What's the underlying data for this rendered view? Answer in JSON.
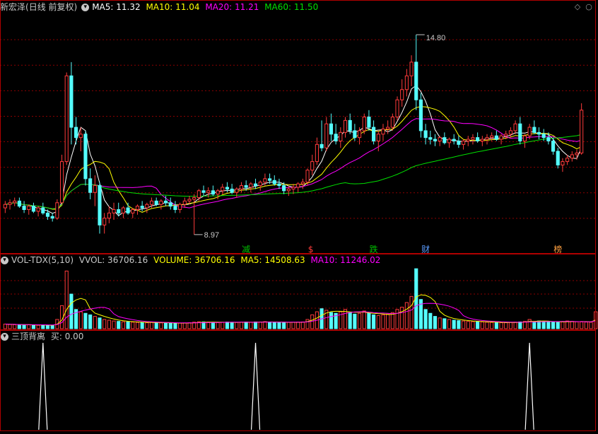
{
  "colors": {
    "background": "#000000",
    "up": "#ff3b3b",
    "down": "#54fcfc",
    "ma5": "#ffffff",
    "ma10": "#ffff00",
    "ma20": "#ff00ff",
    "ma60": "#00e000",
    "grid": "#8b0000"
  },
  "header": {
    "stock": "新宏泽",
    "period": "(日线 前复权)",
    "dropdown_icon": "chevron-down-icon",
    "ma5": "MA5: 11.32",
    "ma10": "MA10: 11.04",
    "ma20": "MA20: 11.21",
    "ma60": "MA60: 11.50"
  },
  "price_markers": {
    "high": "14.80",
    "low": "8.97"
  },
  "event_tags": [
    "减",
    "$",
    "跌",
    "财",
    "榜"
  ],
  "volume_header": {
    "indicator": "VOL-TDX(5,10)",
    "vvol": "VVOL: 36706.16",
    "volume": "VOLUME: 36706.16",
    "ma5": "MA5: 14508.63",
    "ma10": "MA10: 11246.02"
  },
  "signal_header": {
    "indicator": "三顶背离",
    "buy": "买: 0.00"
  },
  "chart_data": [
    {
      "type": "candlestick",
      "title": "新宏泽(日线 前复权)",
      "ylim": [
        8.7,
        15.4
      ],
      "series": [
        {
          "name": "MA5",
          "value": 11.32
        },
        {
          "name": "MA10",
          "value": 11.04
        },
        {
          "name": "MA20",
          "value": 11.21
        },
        {
          "name": "MA60",
          "value": 11.5
        }
      ],
      "annotations": {
        "max": 14.8,
        "min": 8.97
      },
      "ohlc": [
        [
          9.75,
          9.95,
          9.6,
          9.85
        ],
        [
          9.85,
          10.0,
          9.7,
          9.9
        ],
        [
          9.9,
          10.05,
          9.8,
          9.95
        ],
        [
          9.95,
          10.05,
          9.75,
          9.8
        ],
        [
          9.8,
          9.95,
          9.6,
          9.7
        ],
        [
          9.7,
          9.85,
          9.55,
          9.8
        ],
        [
          9.8,
          9.9,
          9.6,
          9.65
        ],
        [
          9.65,
          9.8,
          9.5,
          9.75
        ],
        [
          9.75,
          9.9,
          9.55,
          9.6
        ],
        [
          9.6,
          9.7,
          9.4,
          9.5
        ],
        [
          9.5,
          9.6,
          9.35,
          9.45
        ],
        [
          9.45,
          10.0,
          9.4,
          9.9
        ],
        [
          9.9,
          11.3,
          9.85,
          11.1
        ],
        [
          11.1,
          13.7,
          11.0,
          13.6
        ],
        [
          13.6,
          14.0,
          11.6,
          12.1
        ],
        [
          12.1,
          12.4,
          11.6,
          11.8
        ],
        [
          11.8,
          12.1,
          11.4,
          11.9
        ],
        [
          11.9,
          12.0,
          10.4,
          10.6
        ],
        [
          10.6,
          10.9,
          10.0,
          10.2
        ],
        [
          10.2,
          10.7,
          9.8,
          10.4
        ],
        [
          10.4,
          10.5,
          9.0,
          9.25
        ],
        [
          9.25,
          9.6,
          9.0,
          9.45
        ],
        [
          9.45,
          9.8,
          9.3,
          9.6
        ],
        [
          9.6,
          9.9,
          9.4,
          9.7
        ],
        [
          9.7,
          9.9,
          9.5,
          9.6
        ],
        [
          9.6,
          9.8,
          9.45,
          9.75
        ],
        [
          9.75,
          9.9,
          9.55,
          9.6
        ],
        [
          9.6,
          9.75,
          9.45,
          9.7
        ],
        [
          9.7,
          9.85,
          9.55,
          9.8
        ],
        [
          9.8,
          9.95,
          9.65,
          9.75
        ],
        [
          9.75,
          9.9,
          9.6,
          9.85
        ],
        [
          9.85,
          10.05,
          9.75,
          9.95
        ],
        [
          9.95,
          10.05,
          9.8,
          9.85
        ],
        [
          9.85,
          10.0,
          9.7,
          9.95
        ],
        [
          9.95,
          10.1,
          9.8,
          9.9
        ],
        [
          9.9,
          10.05,
          9.7,
          9.8
        ],
        [
          9.8,
          9.95,
          9.6,
          9.7
        ],
        [
          9.7,
          9.9,
          9.6,
          9.85
        ],
        [
          9.85,
          10.05,
          9.75,
          9.95
        ],
        [
          9.95,
          10.1,
          9.85,
          10.0
        ],
        [
          10.0,
          10.15,
          8.97,
          10.05
        ],
        [
          10.05,
          10.3,
          9.95,
          10.25
        ],
        [
          10.25,
          10.4,
          10.1,
          10.2
        ],
        [
          10.2,
          10.35,
          10.05,
          10.25
        ],
        [
          10.25,
          10.4,
          10.1,
          10.15
        ],
        [
          10.15,
          10.3,
          10.0,
          10.25
        ],
        [
          10.25,
          10.45,
          10.15,
          10.35
        ],
        [
          10.35,
          10.5,
          10.2,
          10.3
        ],
        [
          10.3,
          10.45,
          10.15,
          10.2
        ],
        [
          10.2,
          10.35,
          10.05,
          10.3
        ],
        [
          10.3,
          10.5,
          10.2,
          10.4
        ],
        [
          10.4,
          10.55,
          10.25,
          10.35
        ],
        [
          10.35,
          10.5,
          10.2,
          10.45
        ],
        [
          10.45,
          10.6,
          10.3,
          10.4
        ],
        [
          10.4,
          10.55,
          10.25,
          10.5
        ],
        [
          10.5,
          10.75,
          10.4,
          10.6
        ],
        [
          10.6,
          10.75,
          10.45,
          10.55
        ],
        [
          10.55,
          10.7,
          10.4,
          10.45
        ],
        [
          10.45,
          10.6,
          10.3,
          10.4
        ],
        [
          10.4,
          10.5,
          10.15,
          10.25
        ],
        [
          10.25,
          10.4,
          10.1,
          10.3
        ],
        [
          10.3,
          10.45,
          10.15,
          10.35
        ],
        [
          10.35,
          10.5,
          10.2,
          10.45
        ],
        [
          10.45,
          10.6,
          10.3,
          10.5
        ],
        [
          10.5,
          10.9,
          10.4,
          10.85
        ],
        [
          10.85,
          11.3,
          10.7,
          11.1
        ],
        [
          11.1,
          11.8,
          11.0,
          11.6
        ],
        [
          11.6,
          12.3,
          11.4,
          11.5
        ],
        [
          11.5,
          12.4,
          11.4,
          12.2
        ],
        [
          12.2,
          12.5,
          11.7,
          11.9
        ],
        [
          11.9,
          12.2,
          11.6,
          11.7
        ],
        [
          11.7,
          12.1,
          11.5,
          11.95
        ],
        [
          11.95,
          12.4,
          11.8,
          12.3
        ],
        [
          12.3,
          12.5,
          11.9,
          12.0
        ],
        [
          12.0,
          12.2,
          11.7,
          11.8
        ],
        [
          11.8,
          12.1,
          11.6,
          12.0
        ],
        [
          12.0,
          12.5,
          11.9,
          12.4
        ],
        [
          12.4,
          12.6,
          12.0,
          12.1
        ],
        [
          12.1,
          12.3,
          11.6,
          11.7
        ],
        [
          11.7,
          12.0,
          11.4,
          11.9
        ],
        [
          11.9,
          12.2,
          11.7,
          12.05
        ],
        [
          12.05,
          12.3,
          11.9,
          12.1
        ],
        [
          12.1,
          12.5,
          12.0,
          12.4
        ],
        [
          12.4,
          13.0,
          12.3,
          12.9
        ],
        [
          12.9,
          13.5,
          12.7,
          13.2
        ],
        [
          13.2,
          13.8,
          13.0,
          13.6
        ],
        [
          13.6,
          14.2,
          13.3,
          14.0
        ],
        [
          14.0,
          14.8,
          12.6,
          12.9
        ],
        [
          12.9,
          13.1,
          11.8,
          12.0
        ],
        [
          12.0,
          12.2,
          11.6,
          11.8
        ],
        [
          11.8,
          12.0,
          11.6,
          11.75
        ],
        [
          11.75,
          11.9,
          11.55,
          11.7
        ],
        [
          11.7,
          11.85,
          11.55,
          11.8
        ],
        [
          11.8,
          11.95,
          11.6,
          11.65
        ],
        [
          11.65,
          11.8,
          11.5,
          11.75
        ],
        [
          11.75,
          11.9,
          11.6,
          11.7
        ],
        [
          11.7,
          11.85,
          11.5,
          11.6
        ],
        [
          11.6,
          11.75,
          11.45,
          11.7
        ],
        [
          11.7,
          11.85,
          11.55,
          11.75
        ],
        [
          11.75,
          11.9,
          11.6,
          11.8
        ],
        [
          11.8,
          11.95,
          11.65,
          11.7
        ],
        [
          11.7,
          11.85,
          11.55,
          11.75
        ],
        [
          11.75,
          11.9,
          11.6,
          11.8
        ],
        [
          11.8,
          11.95,
          11.7,
          11.85
        ],
        [
          11.85,
          12.0,
          11.7,
          11.75
        ],
        [
          11.75,
          11.9,
          11.6,
          11.85
        ],
        [
          11.85,
          12.0,
          11.75,
          11.9
        ],
        [
          11.9,
          12.1,
          11.8,
          12.0
        ],
        [
          12.0,
          12.3,
          11.9,
          12.2
        ],
        [
          12.2,
          12.4,
          11.6,
          11.7
        ],
        [
          11.7,
          11.9,
          11.5,
          11.85
        ],
        [
          11.85,
          12.2,
          11.75,
          12.1
        ],
        [
          12.1,
          12.3,
          11.9,
          11.95
        ],
        [
          11.95,
          12.1,
          11.75,
          11.9
        ],
        [
          11.9,
          12.05,
          11.7,
          11.8
        ],
        [
          11.8,
          11.95,
          11.6,
          11.7
        ],
        [
          11.7,
          11.8,
          11.3,
          11.4
        ],
        [
          11.4,
          11.5,
          10.9,
          11.0
        ],
        [
          11.0,
          11.2,
          10.8,
          11.1
        ],
        [
          11.1,
          11.3,
          11.0,
          11.2
        ],
        [
          11.2,
          11.4,
          11.1,
          11.3
        ],
        [
          11.3,
          11.45,
          11.15,
          11.35
        ],
        [
          11.35,
          12.8,
          11.3,
          12.6
        ]
      ]
    },
    {
      "type": "bar",
      "title": "VOL-TDX(5,10)",
      "series": [
        {
          "name": "VOLUME",
          "last": 36706.16
        },
        {
          "name": "MA5",
          "last": 14508.63
        },
        {
          "name": "MA10",
          "last": 11246.02
        }
      ],
      "ylim": [
        0,
        80000
      ],
      "values": [
        6000,
        5500,
        5200,
        5000,
        4800,
        5200,
        4600,
        4500,
        4800,
        4200,
        4000,
        12000,
        30000,
        75000,
        45000,
        25000,
        22000,
        20000,
        18000,
        16000,
        14000,
        12000,
        11000,
        10000,
        9500,
        9000,
        8800,
        8500,
        8200,
        8000,
        7800,
        8200,
        8000,
        7600,
        7400,
        7200,
        7000,
        7300,
        7500,
        7800,
        8500,
        9000,
        8800,
        8600,
        8200,
        8000,
        8400,
        8600,
        8300,
        8100,
        8500,
        8700,
        8400,
        8800,
        8600,
        9200,
        8800,
        8400,
        8200,
        8000,
        8200,
        8400,
        8600,
        8800,
        12000,
        18000,
        22000,
        26000,
        24000,
        21000,
        20000,
        22000,
        25000,
        21000,
        19000,
        20000,
        23000,
        20000,
        18000,
        17000,
        18000,
        19000,
        21000,
        25000,
        28000,
        34000,
        42000,
        78000,
        38000,
        25000,
        20000,
        16000,
        14000,
        13000,
        12000,
        11000,
        10500,
        10000,
        9500,
        9200,
        9000,
        8800,
        8500,
        8200,
        8000,
        7800,
        8000,
        8200,
        8500,
        8800,
        9500,
        12000,
        9000,
        10000,
        9500,
        9000,
        8600,
        8200,
        9000,
        10000,
        9500,
        9000,
        8800,
        8600,
        8400,
        22000
      ]
    },
    {
      "type": "line",
      "title": "三顶背离",
      "series": [
        {
          "name": "买",
          "last": 0.0
        }
      ],
      "ylim": [
        0,
        1
      ],
      "spikes": [
        14,
        91,
        190
      ]
    }
  ]
}
